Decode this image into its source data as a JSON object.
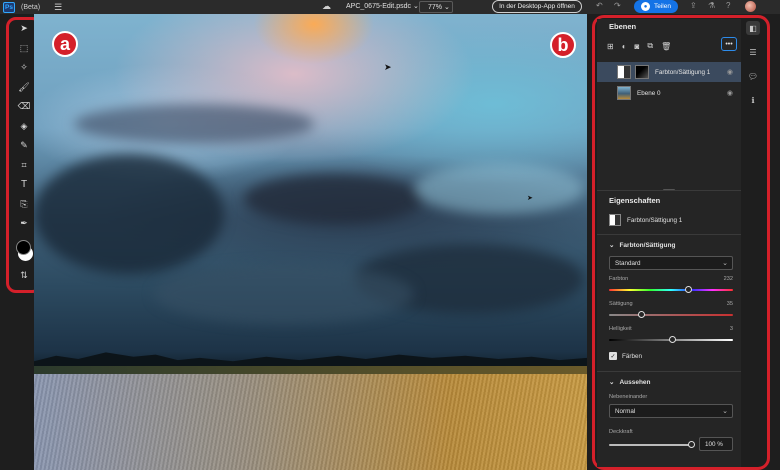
{
  "topbar": {
    "app_badge": "Ps",
    "beta_label": "(Beta)",
    "filename": "APC_0675-Edit.psdc",
    "filename_chevron": "⌄",
    "zoom": "77%",
    "desktop_button": "In der Desktop-App öffnen",
    "share_button": "Teilen"
  },
  "badges": {
    "a": "a",
    "b": "b"
  },
  "tools": [
    "move-tool",
    "marquee-tool",
    "quick-select-tool",
    "brush-tool",
    "eraser-tool",
    "paint-bucket-tool",
    "healing-tool",
    "crop-tool",
    "text-tool",
    "clone-stamp-tool",
    "eyedropper-tool"
  ],
  "layers_panel": {
    "title": "Ebenen",
    "more_label": "•••",
    "layers": [
      {
        "name": "Farbton/Sättigung 1",
        "selected": true
      },
      {
        "name": "Ebene 0",
        "selected": false
      }
    ]
  },
  "properties_panel": {
    "title": "Eigenschaften",
    "layer_name": "Farbton/Sättigung 1",
    "hue_sat_group": "Farbton/Sättigung",
    "preset": "Standard",
    "sliders": [
      {
        "label": "Farbton",
        "value": "232",
        "fraction": 0.64
      },
      {
        "label": "Sättigung",
        "value": "35",
        "fraction": 0.26
      },
      {
        "label": "Helligkeit",
        "value": "3",
        "fraction": 0.51
      }
    ],
    "colorize_label": "Färben",
    "colorize_checked": true,
    "appearance_group": "Aussehen",
    "blend_label": "Nebeneinander",
    "blend_mode": "Normal",
    "opacity_label": "Deckkraft",
    "opacity_value": "100 %",
    "opacity_fraction": 1.0
  },
  "colors": {
    "accent": "#1473e6",
    "highlight": "#d4202a"
  }
}
